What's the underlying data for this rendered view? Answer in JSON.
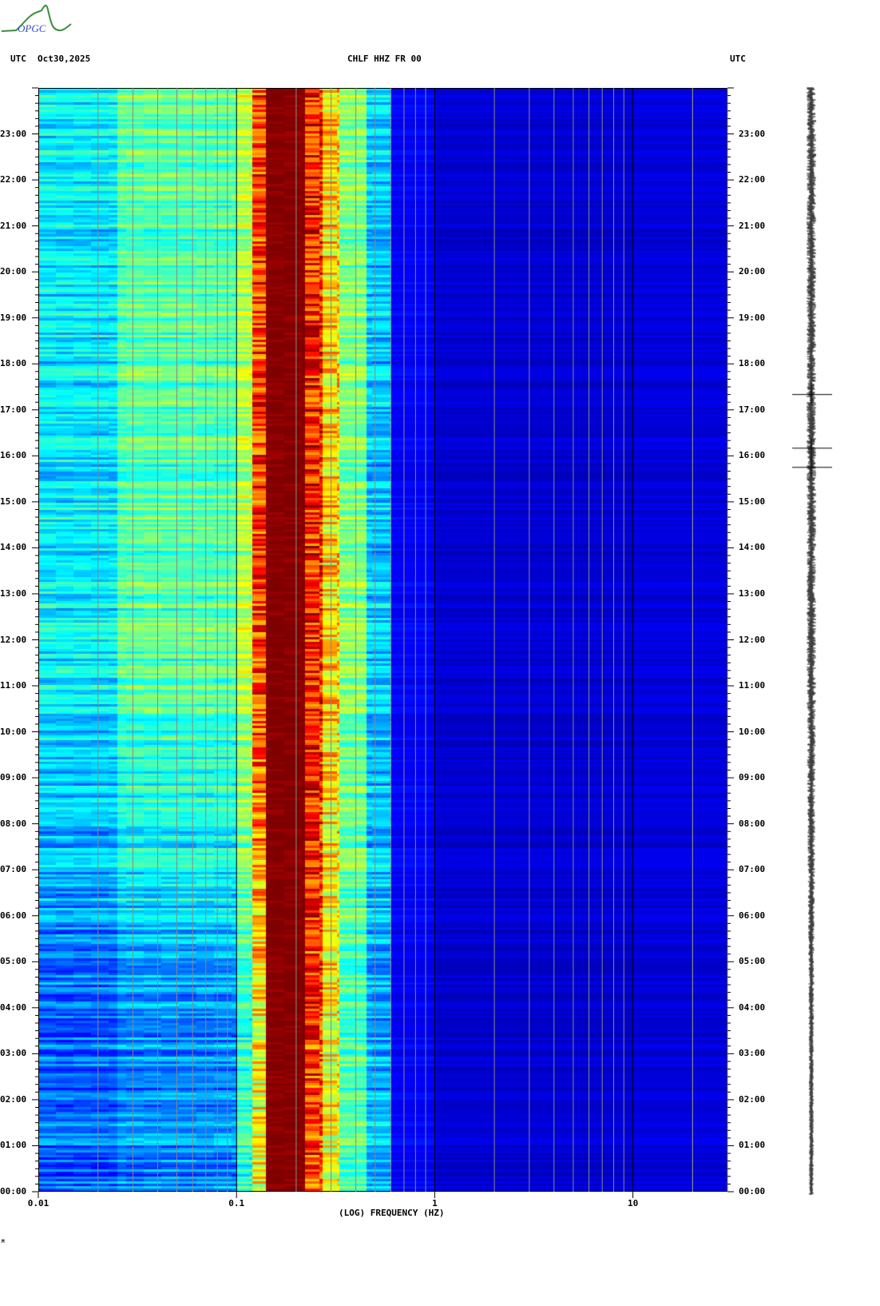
{
  "logo_text": "OPGC",
  "header": {
    "left_tz": "UTC",
    "date": "Oct30,2025",
    "station": "CHLF HHZ FR 00",
    "right_tz": "UTC"
  },
  "footer_mark": "M",
  "chart_data": {
    "type": "heatmap",
    "title": "CHLF HHZ FR 00",
    "xlabel": "(LOG) FREQUENCY (HZ)",
    "ylabel": "",
    "x_scale": "log",
    "xlim": [
      0.01,
      30
    ],
    "x_ticks": [
      "0.01",
      "0.1",
      "1",
      "10"
    ],
    "ylim": [
      "00:00",
      "24:00"
    ],
    "y_ticks": [
      "00:00",
      "01:00",
      "02:00",
      "03:00",
      "04:00",
      "05:00",
      "06:00",
      "07:00",
      "08:00",
      "09:00",
      "10:00",
      "11:00",
      "12:00",
      "13:00",
      "14:00",
      "15:00",
      "16:00",
      "17:00",
      "18:00",
      "19:00",
      "20:00",
      "21:00",
      "22:00",
      "23:00"
    ],
    "grid": true,
    "colormap": "jet",
    "colors": {
      "low": "#00007f",
      "mid": "#00ffff",
      "high": "#7f0000",
      "grid": "#888888"
    },
    "spectral_profile": {
      "freq_hz": [
        0.01,
        0.025,
        0.1,
        0.12,
        0.14,
        0.22,
        0.27,
        0.33,
        0.45,
        0.6,
        1,
        10,
        30
      ],
      "relative_level_late_day": [
        0.36,
        0.46,
        0.55,
        0.82,
        1.0,
        0.85,
        0.66,
        0.5,
        0.32,
        0.12,
        0.08,
        0.09,
        0.1
      ],
      "relative_level_early_day": [
        0.22,
        0.26,
        0.42,
        0.62,
        1.0,
        0.82,
        0.62,
        0.45,
        0.3,
        0.12,
        0.08,
        0.09,
        0.1
      ]
    },
    "events_utc": [
      "17:20",
      "16:10",
      "15:45"
    ]
  }
}
